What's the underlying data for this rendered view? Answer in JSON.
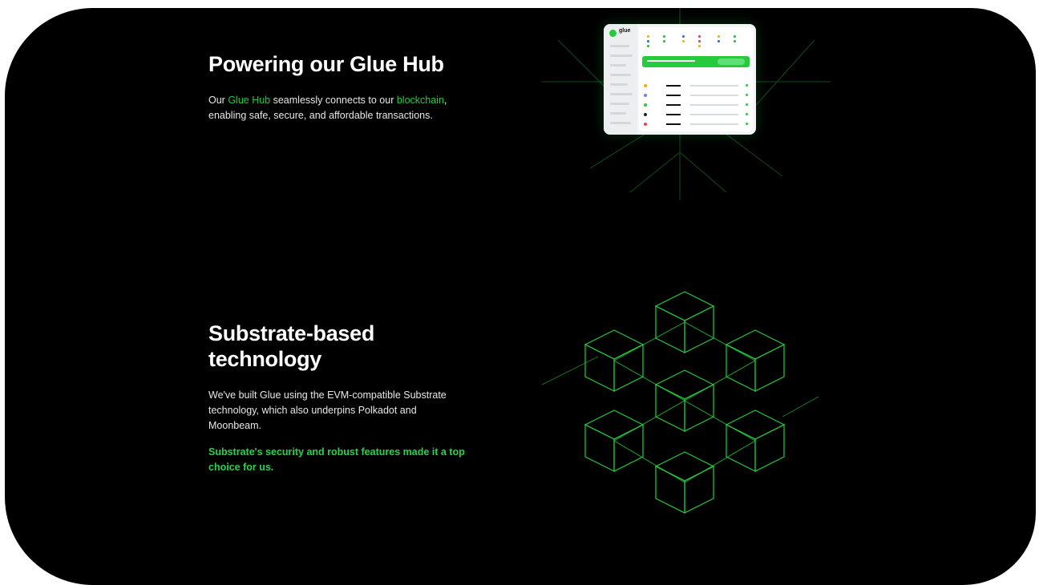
{
  "section_hub": {
    "title": "Powering our Glue Hub",
    "body_prefix": "Our ",
    "link_hub": "Glue Hub",
    "body_mid": " seamlessly connects to our ",
    "link_chain": "blockchain",
    "body_suffix": ", enabling safe, secure, and affordable transactions."
  },
  "section_substrate": {
    "title": "Substrate-based technology",
    "body": "We've built Glue using the EVM-compatible Substrate technology, which also underpins Polkadot and Moonbeam.",
    "highlight": "Substrate's security and robust features made it a top choice for us."
  },
  "mockup": {
    "logo_text": "glue"
  },
  "colors": {
    "background": "#000000",
    "accent": "#27c93f",
    "text": "#ffffff"
  },
  "icons": [
    "glue-logo-icon",
    "cube-network-illustration",
    "dashboard-preview-image"
  ]
}
